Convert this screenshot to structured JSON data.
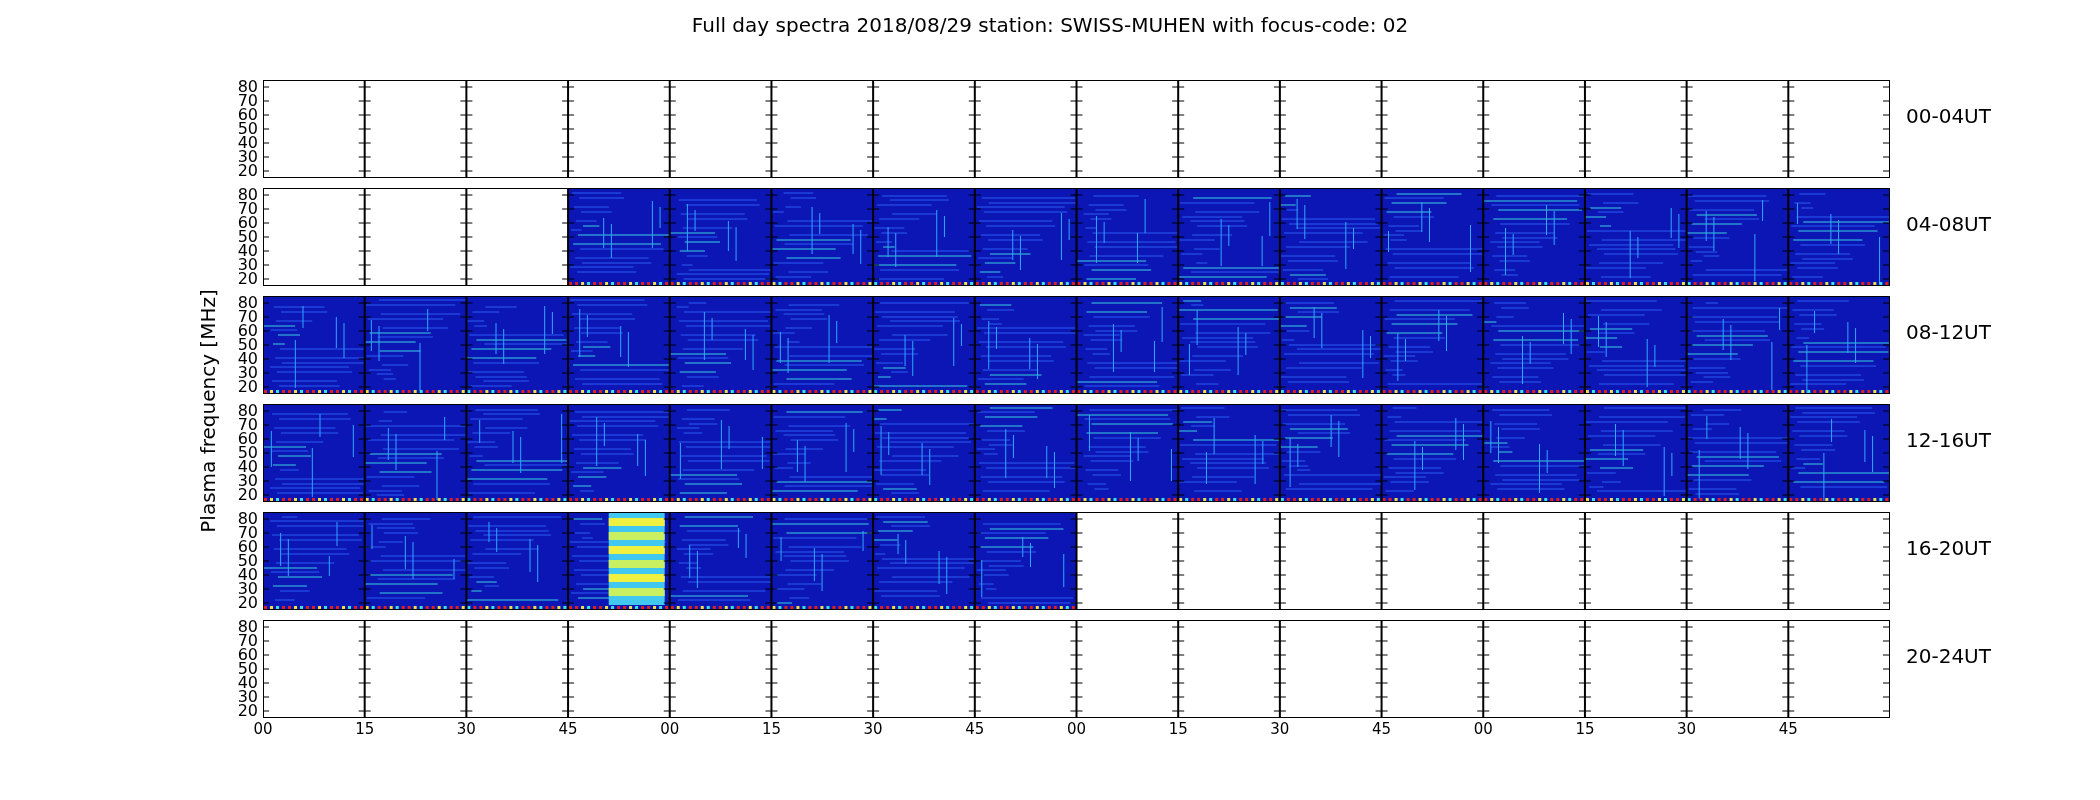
{
  "title": "Full day spectra 2018/08/29 station: SWISS-MUHEN with focus-code: 02",
  "ylabel": "Plasma frequency [MHz]",
  "panels": [
    {
      "label": "00-04UT",
      "yticks": [
        "80",
        "70",
        "60",
        "50",
        "40",
        "30",
        "20"
      ],
      "segments": [
        {
          "kind": "empty"
        },
        {
          "kind": "empty"
        },
        {
          "kind": "empty"
        },
        {
          "kind": "empty"
        },
        {
          "kind": "empty"
        },
        {
          "kind": "empty"
        },
        {
          "kind": "empty"
        },
        {
          "kind": "empty"
        },
        {
          "kind": "empty"
        },
        {
          "kind": "empty"
        },
        {
          "kind": "empty"
        },
        {
          "kind": "empty"
        },
        {
          "kind": "empty"
        },
        {
          "kind": "empty"
        },
        {
          "kind": "empty"
        },
        {
          "kind": "empty"
        }
      ]
    },
    {
      "label": "04-08UT",
      "yticks": [
        "80",
        "70",
        "60",
        "50",
        "40",
        "30",
        "20"
      ],
      "segments": [
        {
          "kind": "empty"
        },
        {
          "kind": "empty"
        },
        {
          "kind": "empty"
        },
        {
          "kind": "spectrum"
        },
        {
          "kind": "spectrum"
        },
        {
          "kind": "spectrum"
        },
        {
          "kind": "spectrum"
        },
        {
          "kind": "spectrum"
        },
        {
          "kind": "spectrum"
        },
        {
          "kind": "spectrum"
        },
        {
          "kind": "spectrum"
        },
        {
          "kind": "spectrum"
        },
        {
          "kind": "spectrum"
        },
        {
          "kind": "spectrum"
        },
        {
          "kind": "spectrum"
        },
        {
          "kind": "spectrum"
        }
      ]
    },
    {
      "label": "08-12UT",
      "yticks": [
        "80",
        "70",
        "60",
        "50",
        "40",
        "30",
        "20"
      ],
      "segments": [
        {
          "kind": "spectrum"
        },
        {
          "kind": "spectrum"
        },
        {
          "kind": "spectrum"
        },
        {
          "kind": "spectrum"
        },
        {
          "kind": "spectrum"
        },
        {
          "kind": "spectrum"
        },
        {
          "kind": "spectrum"
        },
        {
          "kind": "spectrum"
        },
        {
          "kind": "spectrum"
        },
        {
          "kind": "spectrum"
        },
        {
          "kind": "spectrum"
        },
        {
          "kind": "spectrum"
        },
        {
          "kind": "spectrum"
        },
        {
          "kind": "spectrum"
        },
        {
          "kind": "spectrum"
        },
        {
          "kind": "spectrum"
        }
      ]
    },
    {
      "label": "12-16UT",
      "yticks": [
        "80",
        "70",
        "60",
        "50",
        "40",
        "30",
        "20"
      ],
      "segments": [
        {
          "kind": "spectrum"
        },
        {
          "kind": "spectrum"
        },
        {
          "kind": "spectrum"
        },
        {
          "kind": "spectrum"
        },
        {
          "kind": "spectrum"
        },
        {
          "kind": "spectrum"
        },
        {
          "kind": "spectrum"
        },
        {
          "kind": "spectrum"
        },
        {
          "kind": "spectrum"
        },
        {
          "kind": "spectrum"
        },
        {
          "kind": "spectrum"
        },
        {
          "kind": "spectrum"
        },
        {
          "kind": "spectrum"
        },
        {
          "kind": "spectrum"
        },
        {
          "kind": "spectrum"
        },
        {
          "kind": "spectrum"
        }
      ]
    },
    {
      "label": "16-20UT",
      "yticks": [
        "80",
        "70",
        "60",
        "50",
        "40",
        "30",
        "20"
      ],
      "segments": [
        {
          "kind": "spectrum"
        },
        {
          "kind": "spectrum"
        },
        {
          "kind": "spectrum"
        },
        {
          "kind": "burst"
        },
        {
          "kind": "spectrum"
        },
        {
          "kind": "spectrum"
        },
        {
          "kind": "spectrum"
        },
        {
          "kind": "spectrum"
        },
        {
          "kind": "empty"
        },
        {
          "kind": "empty"
        },
        {
          "kind": "empty"
        },
        {
          "kind": "empty"
        },
        {
          "kind": "empty"
        },
        {
          "kind": "empty"
        },
        {
          "kind": "empty"
        },
        {
          "kind": "empty"
        }
      ]
    },
    {
      "label": "20-24UT",
      "yticks": [
        "80",
        "70",
        "60",
        "50",
        "40",
        "30",
        "20"
      ],
      "segments": [
        {
          "kind": "empty"
        },
        {
          "kind": "empty"
        },
        {
          "kind": "empty"
        },
        {
          "kind": "empty"
        },
        {
          "kind": "empty"
        },
        {
          "kind": "empty"
        },
        {
          "kind": "empty"
        },
        {
          "kind": "empty"
        },
        {
          "kind": "empty"
        },
        {
          "kind": "empty"
        },
        {
          "kind": "empty"
        },
        {
          "kind": "empty"
        },
        {
          "kind": "empty"
        },
        {
          "kind": "empty"
        },
        {
          "kind": "empty"
        },
        {
          "kind": "empty"
        }
      ]
    }
  ],
  "xticks": [
    "00",
    "15",
    "30",
    "45",
    "00",
    "15",
    "30",
    "45",
    "00",
    "15",
    "30",
    "45",
    "00",
    "15",
    "30",
    "45"
  ]
}
